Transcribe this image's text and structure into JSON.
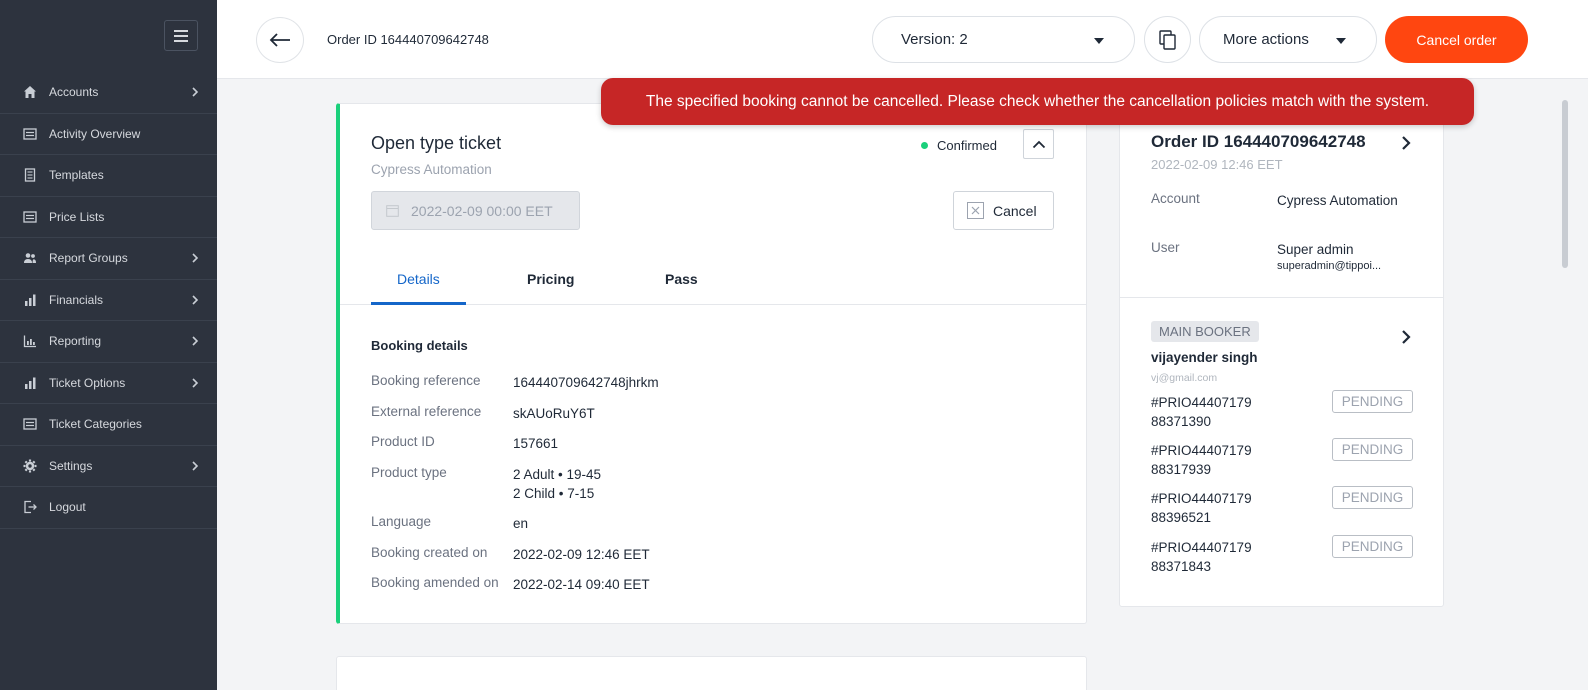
{
  "sidebar": {
    "items": [
      {
        "label": "Accounts",
        "icon": "home-icon",
        "has_submenu": true
      },
      {
        "label": "Activity Overview",
        "icon": "list-icon",
        "has_submenu": false
      },
      {
        "label": "Templates",
        "icon": "document-icon",
        "has_submenu": false
      },
      {
        "label": "Price Lists",
        "icon": "list-icon",
        "has_submenu": false
      },
      {
        "label": "Report Groups",
        "icon": "users-icon",
        "has_submenu": true
      },
      {
        "label": "Financials",
        "icon": "bar-chart-icon",
        "has_submenu": true
      },
      {
        "label": "Reporting",
        "icon": "chart-icon",
        "has_submenu": true
      },
      {
        "label": "Ticket Options",
        "icon": "bar-chart-icon",
        "has_submenu": true
      },
      {
        "label": "Ticket Categories",
        "icon": "list-icon",
        "has_submenu": false
      },
      {
        "label": "Settings",
        "icon": "gear-icon",
        "has_submenu": true
      },
      {
        "label": "Logout",
        "icon": "logout-icon",
        "has_submenu": false
      }
    ]
  },
  "header": {
    "order_title": "Order ID 164440709642748",
    "version_label": "Version: 2",
    "more_actions_label": "More actions",
    "cancel_order_label": "Cancel order"
  },
  "toast": {
    "message": "The specified booking cannot be cancelled. Please check whether the cancellation policies match with the system."
  },
  "ticket": {
    "title": "Open type ticket",
    "subtitle": "Cypress Automation",
    "status": "Confirmed",
    "date": "2022-02-09 00:00 EET",
    "cancel_label": "Cancel",
    "tabs": [
      "Details",
      "Pricing",
      "Pass"
    ],
    "section_title": "Booking details",
    "details": {
      "booking_reference": {
        "label": "Booking reference",
        "value": "164440709642748jhrkm"
      },
      "external_reference": {
        "label": "External reference",
        "value": "skAUoRuY6T"
      },
      "product_id": {
        "label": "Product ID",
        "value": "157661"
      },
      "product_type": {
        "label": "Product type",
        "value_line1": "2 Adult • 19-45",
        "value_line2": "2 Child • 7-15"
      },
      "language": {
        "label": "Language",
        "value": "en"
      },
      "booking_created": {
        "label": "Booking created on",
        "value": "2022-02-09 12:46 EET"
      },
      "booking_amended": {
        "label": "Booking amended on",
        "value": "2022-02-14 09:40 EET"
      }
    }
  },
  "order_panel": {
    "order_id": "Order ID 164440709642748",
    "order_date": "2022-02-09 12:46 EET",
    "account_label": "Account",
    "account_value": "Cypress Automation",
    "user_label": "User",
    "user_name": "Super admin",
    "user_email": "superadmin@tippoi...",
    "booker_badge": "MAIN BOOKER",
    "booker_name": "vijayender singh",
    "booker_email": "vj@gmail.com",
    "tickets": [
      {
        "ref_line1": "#PRIO44407179",
        "ref_line2": "88371390",
        "status": "PENDING"
      },
      {
        "ref_line1": "#PRIO44407179",
        "ref_line2": "88317939",
        "status": "PENDING"
      },
      {
        "ref_line1": "#PRIO44407179",
        "ref_line2": "88396521",
        "status": "PENDING"
      },
      {
        "ref_line1": "#PRIO44407179",
        "ref_line2": "88371843",
        "status": "PENDING"
      }
    ]
  },
  "colors": {
    "sidebar_bg": "#2d333e",
    "accent_orange": "#ff4610",
    "toast_red": "#c62626",
    "confirmed_green": "#1ad07b",
    "tab_active_blue": "#1466c9"
  }
}
